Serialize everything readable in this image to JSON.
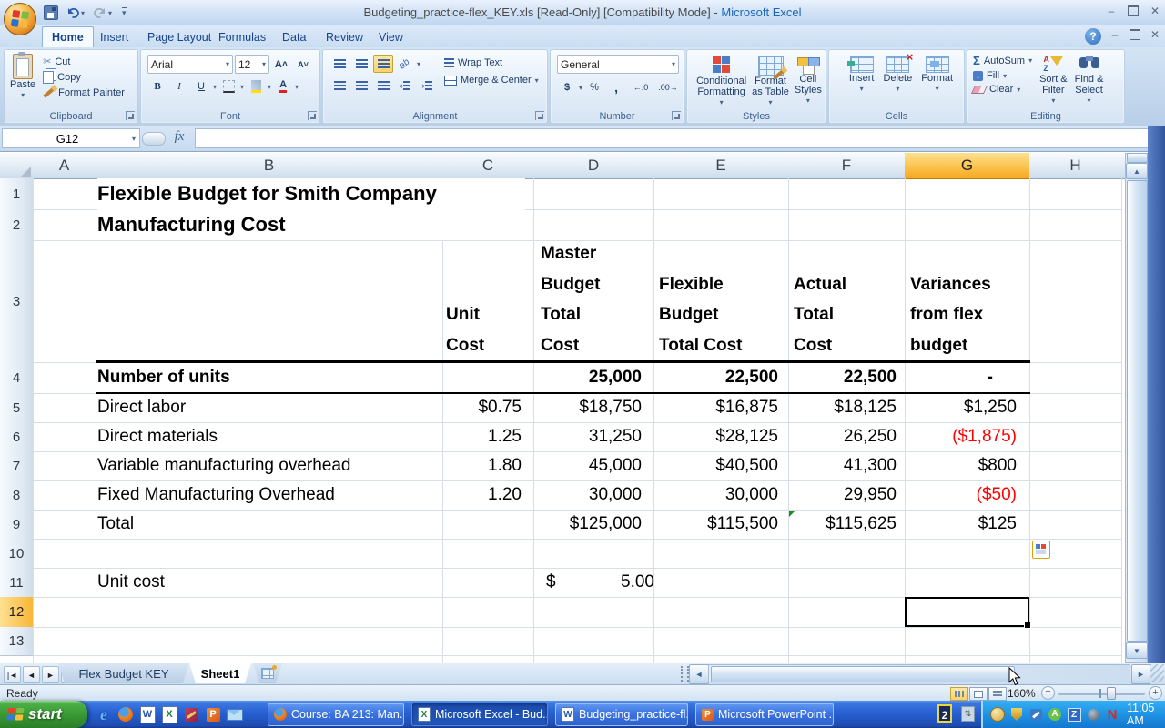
{
  "window": {
    "title_file": "Budgeting_practice-flex_KEY.xls  [Read-Only]  [Compatibility Mode] -",
    "title_app": "Microsoft Excel"
  },
  "ribbon": {
    "tabs": [
      "Home",
      "Insert",
      "Page Layout",
      "Formulas",
      "Data",
      "Review",
      "View"
    ],
    "active_tab": "Home",
    "clipboard": {
      "label": "Clipboard",
      "paste": "Paste",
      "cut": "Cut",
      "copy": "Copy",
      "format_painter": "Format Painter"
    },
    "font": {
      "label": "Font",
      "name": "Arial",
      "size": "12"
    },
    "alignment": {
      "label": "Alignment",
      "wrap_text": "Wrap Text",
      "merge_center": "Merge & Center"
    },
    "number": {
      "label": "Number",
      "format": "General",
      "currency": "$",
      "percent": "%",
      "comma": ",",
      "inc_decimal": "←.0",
      "dec_decimal": ".00→"
    },
    "styles": {
      "label": "Styles",
      "conditional": [
        "Conditional",
        "Formatting"
      ],
      "format_table": [
        "Format",
        "as Table"
      ],
      "cell_styles": [
        "Cell",
        "Styles"
      ]
    },
    "cells": {
      "label": "Cells",
      "insert": "Insert",
      "delete": "Delete",
      "format": "Format"
    },
    "editing": {
      "label": "Editing",
      "sigma": "Σ",
      "autosum": "AutoSum",
      "fill": "Fill",
      "clear": "Clear",
      "sort_filter": [
        "Sort &",
        "Filter"
      ],
      "find_select": [
        "Find &",
        "Select"
      ]
    }
  },
  "formula_bar": {
    "name_box": "G12",
    "fx": "fx"
  },
  "sheet": {
    "selected_cell": "G12",
    "columns": [
      "A",
      "B",
      "C",
      "D",
      "E",
      "F",
      "G",
      "H"
    ],
    "rows_nums": [
      "1",
      "2",
      "3",
      "4",
      "5",
      "6",
      "7",
      "8",
      "9",
      "10",
      "11",
      "12",
      "13"
    ],
    "title1": "Flexible Budget for Smith Company",
    "title2": "Manufacturing Cost",
    "hdr_unit": [
      "Unit",
      "Cost"
    ],
    "hdr_master": [
      "Master",
      "Budget",
      "Total",
      "Cost"
    ],
    "hdr_flex": [
      "Flexible",
      "Budget",
      "Total Cost"
    ],
    "hdr_actual": [
      "Actual",
      "Total",
      "Cost"
    ],
    "hdr_var": [
      "Variances",
      "from flex",
      "budget"
    ],
    "rows": [
      {
        "label": "Number of units",
        "unit": "",
        "master": "25,000",
        "flex": "22,500",
        "actual": "22,500",
        "var": "-"
      },
      {
        "label": "Direct labor",
        "unit": "$0.75",
        "master": "$18,750",
        "flex": "$16,875",
        "actual": "$18,125",
        "var": "$1,250"
      },
      {
        "label": "Direct materials",
        "unit": "1.25",
        "master": "31,250",
        "flex": "$28,125",
        "actual": "26,250",
        "var": "($1,875)"
      },
      {
        "label": "Variable manufacturing overhead",
        "unit": "1.80",
        "master": "45,000",
        "flex": "$40,500",
        "actual": "41,300",
        "var": "$800"
      },
      {
        "label": "Fixed Manufacturing Overhead",
        "unit": "1.20",
        "master": "30,000",
        "flex": "30,000",
        "actual": "29,950",
        "var": "($50)"
      },
      {
        "label": "Total",
        "unit": "",
        "master": "$125,000",
        "flex": "$115,500",
        "actual": "$115,625",
        "var": "$125"
      }
    ],
    "unit_cost": {
      "label": "Unit cost",
      "currency": "$",
      "value": "5.00"
    }
  },
  "sheet_tabs": {
    "tab1": "Flex Budget KEY",
    "tab2": "Sheet1",
    "active": "Sheet1"
  },
  "status": {
    "ready": "Ready",
    "zoom": "160%"
  },
  "taskbar": {
    "start": "start",
    "buttons": [
      {
        "label": "Course: BA 213: Man...",
        "icon": "firefox-icon"
      },
      {
        "label": "Microsoft Excel - Bud...",
        "icon": "excel-icon",
        "active": true
      },
      {
        "label": "Budgeting_practice-fl...",
        "icon": "word-document-icon"
      },
      {
        "label": "Microsoft PowerPoint ...",
        "icon": "powerpoint-icon"
      }
    ],
    "badge": "2",
    "time": "11:05 AM"
  },
  "icons": {
    "office-button": "office-orb",
    "save": "floppy-disk",
    "undo": "curved-arrow-left",
    "redo": "curved-arrow-right",
    "help": "question-circle",
    "cut": "scissors",
    "copy": "two-pages",
    "format-painter": "brush",
    "autosum": "sigma",
    "sort-filter": "az-funnel",
    "find-select": "binoculars",
    "quick_launch": [
      "internet-explorer-icon",
      "firefox-icon",
      "word-icon",
      "excel-icon",
      "access-icon",
      "powerpoint-icon",
      "outlook-express-icon"
    ],
    "tray": [
      "face-icon",
      "shield-icon",
      "tools-icon",
      "antivirus-a-icon",
      "z-icon",
      "swirl-icon",
      "novell-n-icon"
    ]
  },
  "colors": {
    "header_selected": "#F9B73F",
    "negative_value": "#FF0000",
    "xp_taskbar": "#2E66D8",
    "xp_start_green": "#37972F",
    "excel_active_tab": "#F5FAFE"
  }
}
